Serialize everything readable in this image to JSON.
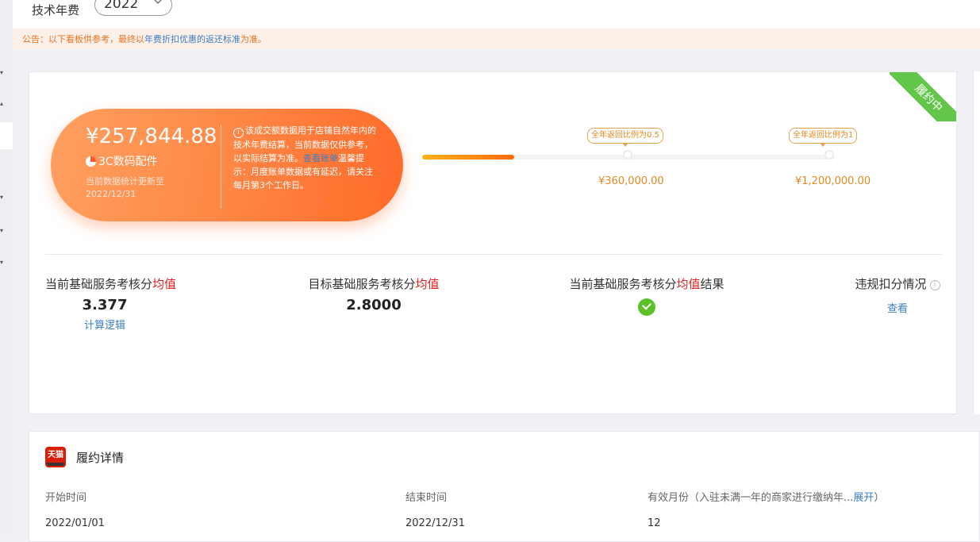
{
  "header": {
    "title": "技术年费",
    "year": "2022"
  },
  "notice": {
    "prefix": "公告：以下看板供参考，最终以",
    "link": "年费折扣优惠的返还标准",
    "suffix": "为准。"
  },
  "summary": {
    "amount": "¥257,844.88",
    "category": "3C数码配件",
    "updated_label": "当前数据统计更新至",
    "updated_date": "2022/12/31",
    "note_before_link": "该成交额数据用于店铺自然年内的技术年费结算，当前数据仅供参考，以实际结算为准。",
    "note_link": "查看账单",
    "note_after_link": "温馨提示：月度账单数据或有延迟，请关注每月第3个工作日。",
    "status": "履约中"
  },
  "progress": {
    "fill_fraction": 0.224,
    "milestones": [
      {
        "tag": "全年返回比例为0.5",
        "amount": "¥360,000.00"
      },
      {
        "tag": "全年返回比例为1",
        "amount": "¥1,200,000.00"
      }
    ]
  },
  "metrics": [
    {
      "title_pre": "当前基础服务考核分",
      "title_hl": "均值",
      "title_post": "",
      "value": "3.377",
      "link": "计算逻辑"
    },
    {
      "title_pre": "目标基础服务考核分",
      "title_hl": "均值",
      "title_post": "",
      "value": "2.8000"
    },
    {
      "title_pre": "当前基础服务考核分",
      "title_hl": "均值",
      "title_post": "结果",
      "result_icon": "check-circle-icon"
    },
    {
      "title_pre": "违规扣分情况",
      "link": "查看"
    }
  ],
  "details": {
    "title": "履约详情",
    "logo_text": "天猫",
    "columns": [
      {
        "label": "开始时间",
        "value": "2022/01/01"
      },
      {
        "label": "结束时间",
        "value": "2022/12/31"
      },
      {
        "label": "有效月份（入驻未满一年的商家进行缴纳年...",
        "link": "展开",
        "label_tail": "）",
        "value": "12"
      }
    ]
  },
  "colors": {
    "accent": "#ff6a2a",
    "link": "#3b7ec4",
    "success": "#5cc02a",
    "highlight": "#e02020"
  }
}
